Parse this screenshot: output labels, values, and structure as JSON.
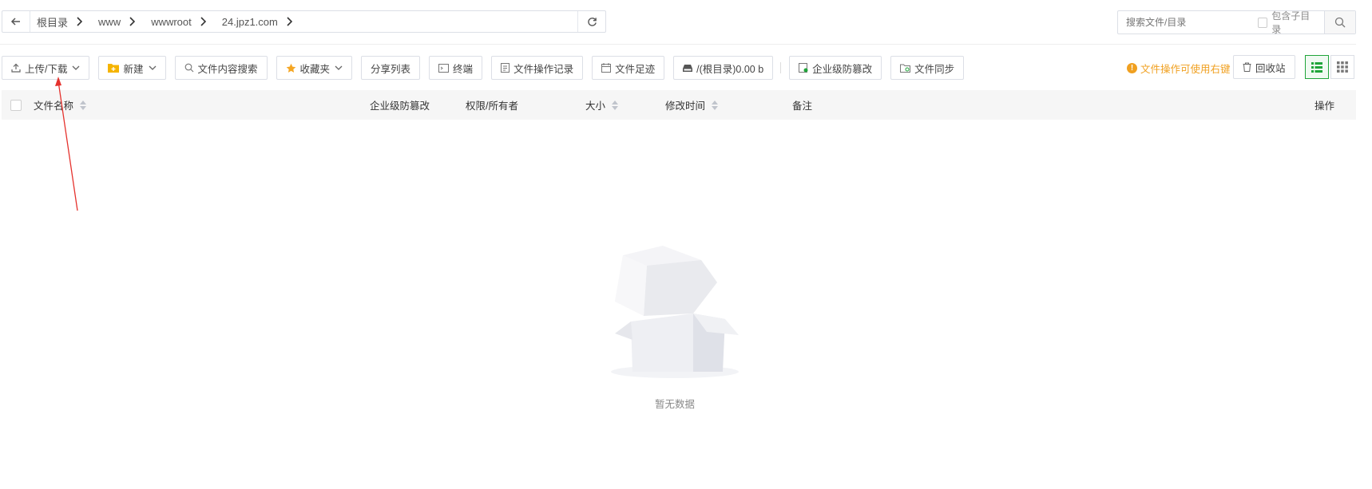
{
  "address": {
    "crumbs": [
      "根目录",
      "www",
      "wwwroot",
      "24.jpz1.com"
    ]
  },
  "search": {
    "placeholder": "搜索文件/目录",
    "include_sub_label": "包含子目录"
  },
  "toolbar": {
    "upload": "上传/下载",
    "new": "新建",
    "content_search": "文件内容搜索",
    "favorites": "收藏夹",
    "share_list": "分享列表",
    "terminal": "终端",
    "op_log": "文件操作记录",
    "footprint": "文件足迹",
    "disk": "/(根目录)0.00 b",
    "tamper": "企业级防篡改",
    "sync": "文件同步",
    "tip": "文件操作可使用右键",
    "recycle": "回收站"
  },
  "table": {
    "headers": {
      "name": "文件名称",
      "tamper": "企业级防篡改",
      "perm": "权限/所有者",
      "size": "大小",
      "mtime": "修改时间",
      "note": "备注",
      "ops": "操作"
    }
  },
  "empty": {
    "text": "暂无数据"
  },
  "colors": {
    "accent": "#20a53a",
    "warning": "#f0a020",
    "annotation": "#e5322d"
  },
  "icons": [
    "back-arrow-icon",
    "chevron-right-icon",
    "refresh-icon",
    "search-icon",
    "upload-icon",
    "folder-plus-icon",
    "star-icon",
    "terminal-icon",
    "log-icon",
    "calendar-icon",
    "disk-icon",
    "shield-icon",
    "sync-folder-icon",
    "info-icon",
    "trash-icon",
    "list-view-icon",
    "grid-view-icon"
  ]
}
